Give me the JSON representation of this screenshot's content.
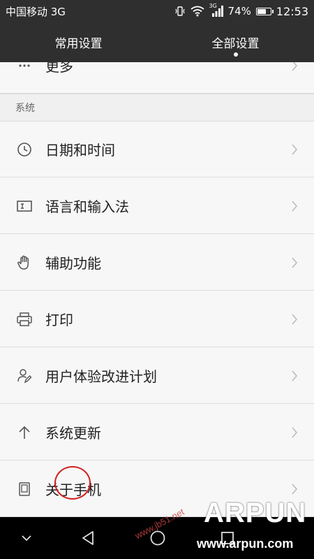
{
  "status_bar": {
    "carrier": "中国移动 3G",
    "network_badge": "3G",
    "battery": "74%",
    "battery_level": 0.74,
    "time": "12:53"
  },
  "tabs": [
    {
      "label": "常用设置",
      "active": false
    },
    {
      "label": "全部设置",
      "active": true
    }
  ],
  "settings": {
    "more_label": "更多",
    "section_title": "系统",
    "items": [
      {
        "label": "日期和时间",
        "icon": "clock-icon"
      },
      {
        "label": "语言和输入法",
        "icon": "keyboard-icon"
      },
      {
        "label": "辅助功能",
        "icon": "hand-icon"
      },
      {
        "label": "打印",
        "icon": "printer-icon"
      },
      {
        "label": "用户体验改进计划",
        "icon": "user-experience-icon"
      },
      {
        "label": "系统更新",
        "icon": "arrow-up-icon"
      },
      {
        "label": "关于手机",
        "icon": "phone-icon"
      }
    ]
  },
  "watermark": {
    "brand": "ARPUN",
    "url": "www.arpun.com",
    "site": "www.jb51.net"
  },
  "colors": {
    "header_bg": "#2f2f2f",
    "content_bg": "#f7f7f7",
    "annotation_red": "#d02020"
  }
}
